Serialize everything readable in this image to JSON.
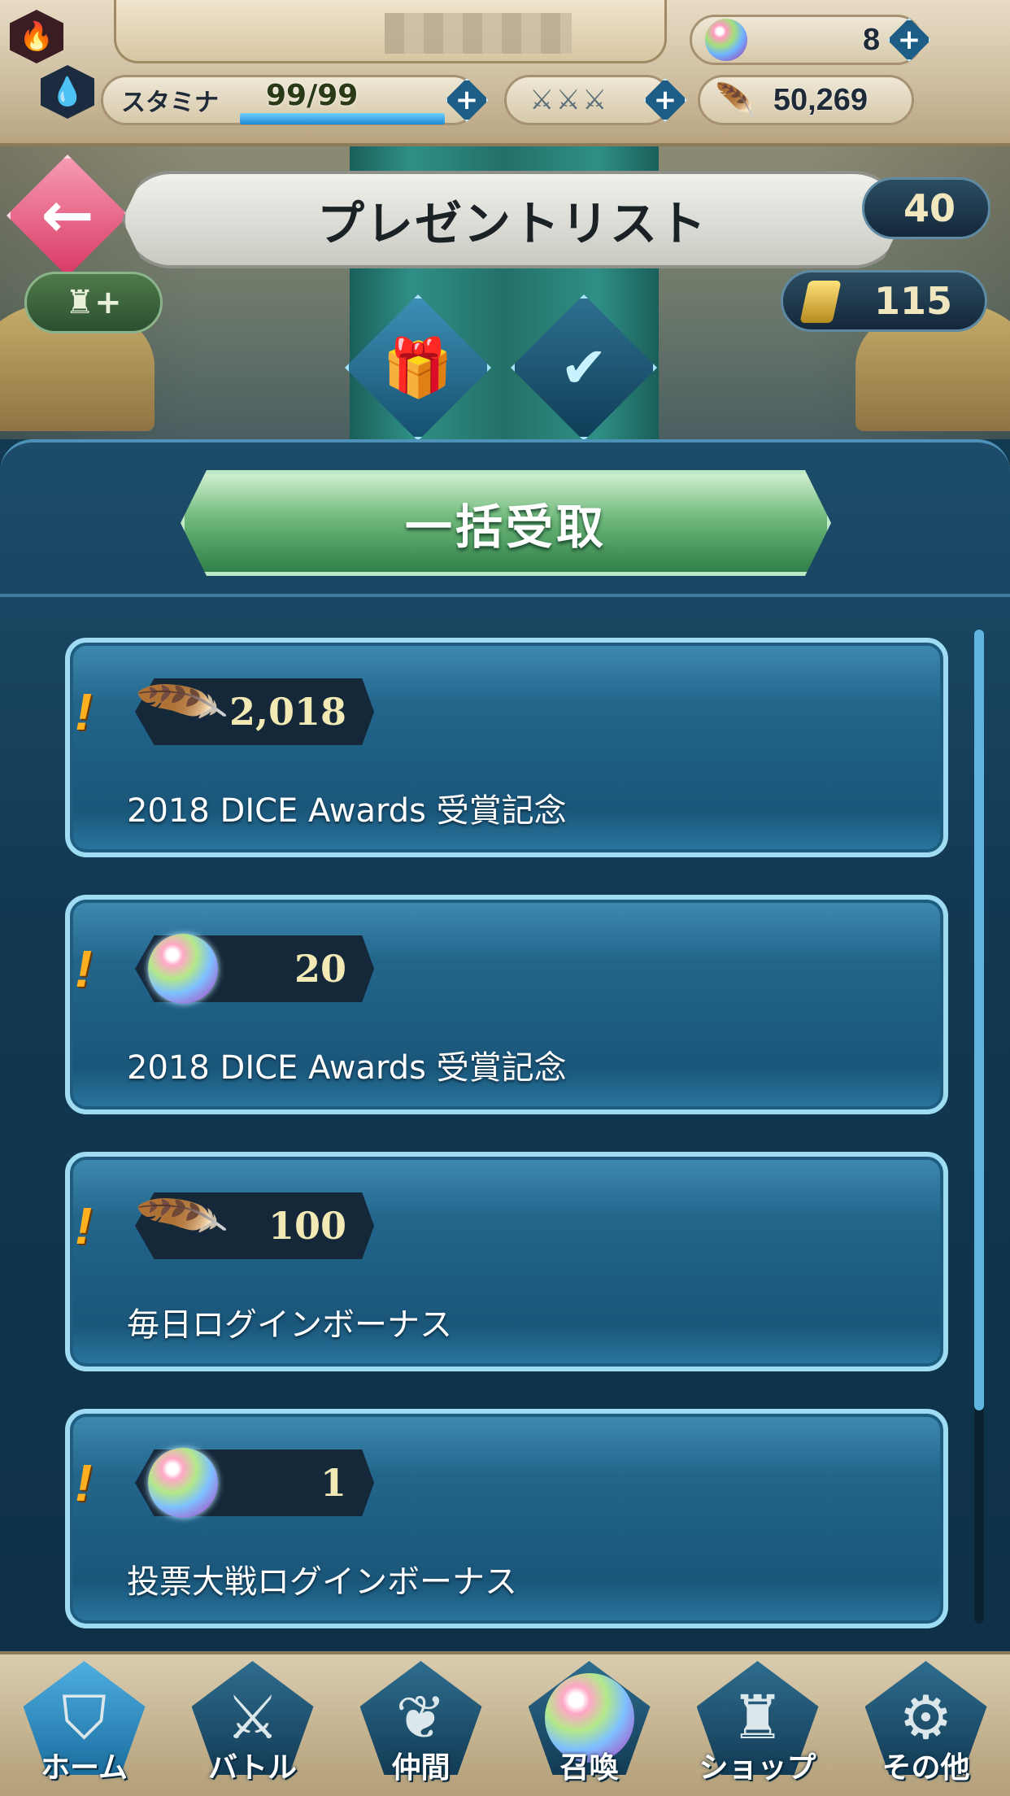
{
  "status": {
    "orbs": "8",
    "stamina_label": "スタミナ",
    "stamina_value": "99/99",
    "stamina_fraction": 1.0,
    "feathers": "50,269",
    "plus": "+"
  },
  "header": {
    "title": "プレゼントリスト",
    "counter_top": "40",
    "counter_bottom": "115"
  },
  "bulk_button": "一括受取",
  "presents": [
    {
      "icon": "feather-icon",
      "amount": "2,018",
      "caption": "2018 DICE Awards 受賞記念"
    },
    {
      "icon": "orb-icon",
      "amount": "20",
      "caption": "2018 DICE Awards 受賞記念"
    },
    {
      "icon": "feather-icon",
      "amount": "100",
      "caption": "毎日ログインボーナス"
    },
    {
      "icon": "orb-icon",
      "amount": "1",
      "caption": "投票大戦ログインボーナス"
    }
  ],
  "nav": [
    {
      "label": "ホーム",
      "icon": "home-crest-icon",
      "active": true
    },
    {
      "label": "バトル",
      "icon": "crossed-swords-icon",
      "active": false
    },
    {
      "label": "仲間",
      "icon": "wing-icon",
      "active": false
    },
    {
      "label": "召喚",
      "icon": "orb-icon",
      "active": false
    },
    {
      "label": "ショップ",
      "icon": "castle-icon",
      "active": false
    },
    {
      "label": "その他",
      "icon": "gear-icon",
      "active": false
    }
  ],
  "colors": {
    "accent_blue": "#4faee0",
    "bulk_green": "#6fb97b",
    "back_pink": "#d93b66",
    "amount_yellow": "#f3e9b5",
    "alert_orange": "#ffb020"
  }
}
